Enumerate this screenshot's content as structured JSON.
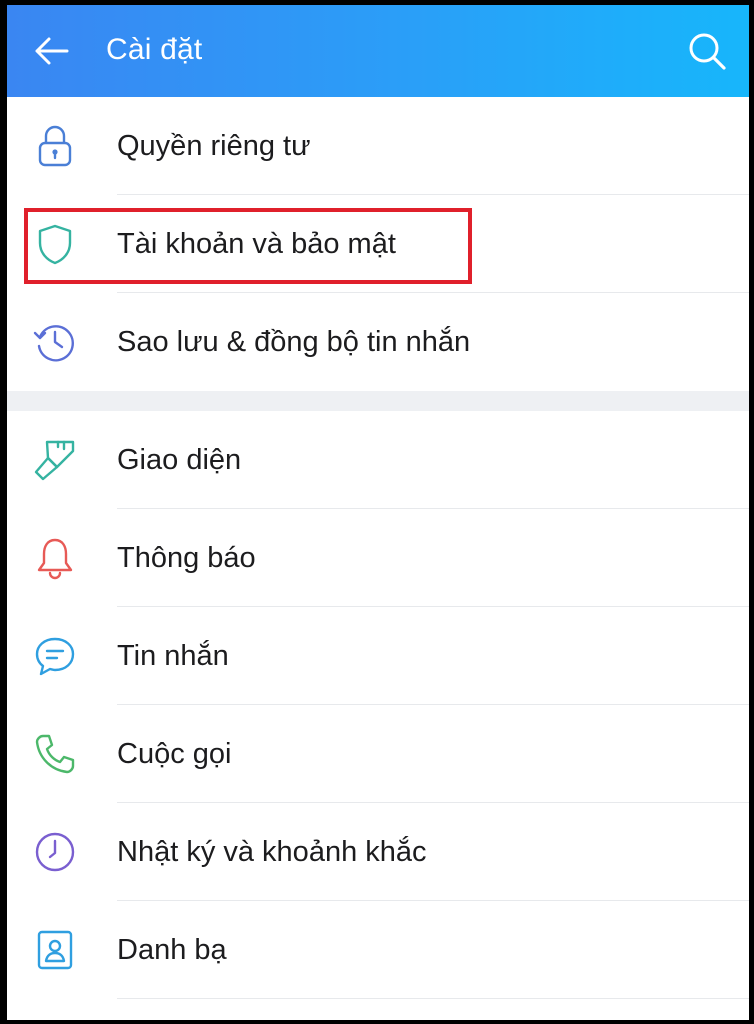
{
  "header": {
    "title": "Cài đặt",
    "back_icon": "arrow-left-icon",
    "search_icon": "search-icon",
    "gradient": [
      "#3a86f2",
      "#17b6fb"
    ]
  },
  "groups": [
    {
      "items": [
        {
          "label": "Quyền riêng tư",
          "icon": "lock-icon",
          "color": "#4a7fd6"
        },
        {
          "label": "Tài khoản và bảo mật",
          "icon": "shield-icon",
          "color": "#35b3a1",
          "highlighted": true
        },
        {
          "label": "Sao lưu & đồng bộ tin nhắn",
          "icon": "history-clock-icon",
          "color": "#5b6fd6"
        }
      ]
    },
    {
      "items": [
        {
          "label": "Giao diện",
          "icon": "paint-brush-icon",
          "color": "#35b3a1"
        },
        {
          "label": "Thông báo",
          "icon": "bell-icon",
          "color": "#e75a56"
        },
        {
          "label": "Tin nhắn",
          "icon": "chat-bubble-icon",
          "color": "#2f9fe0"
        },
        {
          "label": "Cuộc gọi",
          "icon": "phone-icon",
          "color": "#4cb86a"
        },
        {
          "label": "Nhật ký và khoảnh khắc",
          "icon": "clock-icon",
          "color": "#7a5fd0"
        },
        {
          "label": "Danh bạ",
          "icon": "contact-card-icon",
          "color": "#2f9fe0"
        }
      ]
    }
  ],
  "highlight_color": "#e0202b"
}
